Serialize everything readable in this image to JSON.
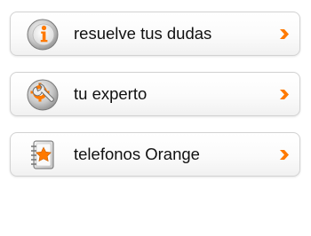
{
  "menu": {
    "items": [
      {
        "label": "resuelve tus dudas",
        "icon": "info-icon"
      },
      {
        "label": "tu experto",
        "icon": "wrench-gear-icon"
      },
      {
        "label": "telefonos Orange",
        "icon": "address-book-star-icon"
      }
    ]
  },
  "colors": {
    "accent": "#ff7900",
    "text": "#111111",
    "border": "#d2d2d2",
    "icon_grey": "#9a9a9a"
  }
}
